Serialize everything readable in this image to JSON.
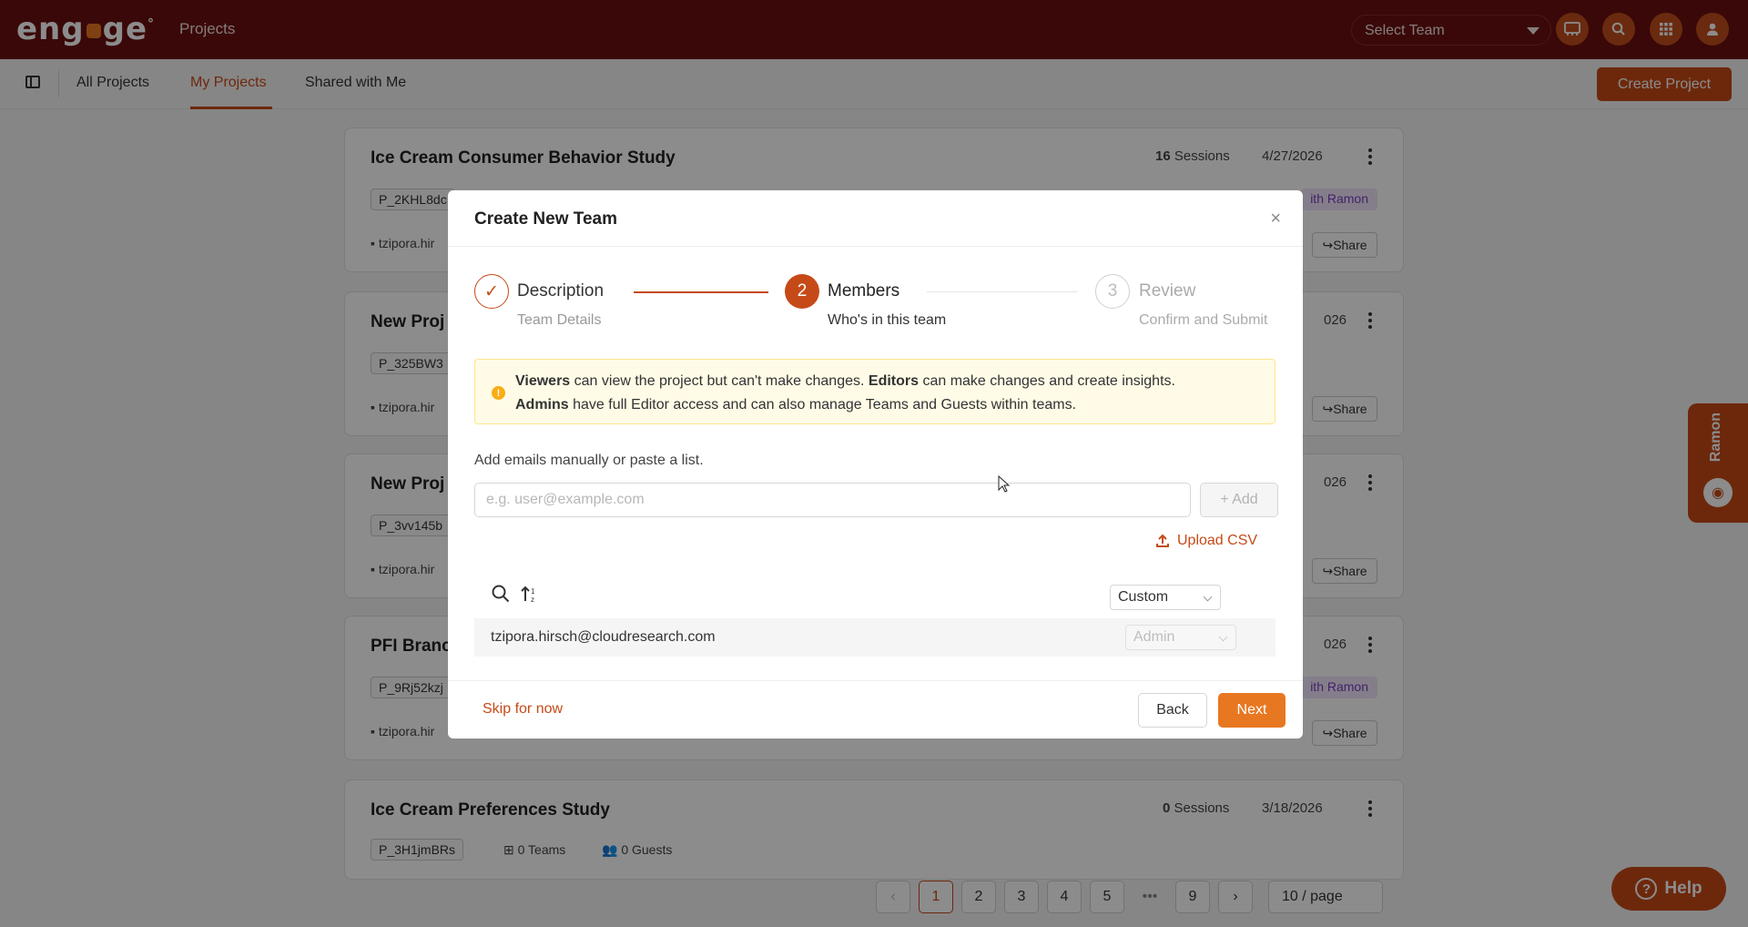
{
  "app": {
    "logo_left": "eng",
    "logo_right": "ge",
    "logo_tm": "°",
    "section_title": "Projects",
    "team_select_placeholder": "Select Team"
  },
  "icons": {
    "workspace": "workspace-icon",
    "search": "search-icon",
    "apps": "grid-icon",
    "user": "user-icon"
  },
  "subnav": {
    "tabs": [
      "All Projects",
      "My Projects",
      "Shared with Me"
    ],
    "active_tab": "My Projects",
    "create_button": "Create Project"
  },
  "cards": [
    {
      "title": "Ice Cream Consumer Behavior Study",
      "id": "P_2KHL8dc",
      "owner": "tzipora.hir",
      "sessions_count": "16",
      "sessions_label": "Sessions",
      "date": "4/27/2026",
      "tag": "ith Ramon",
      "share": "Share"
    },
    {
      "title": "New Proj",
      "id": "P_325BW3",
      "owner": "tzipora.hir",
      "sessions_count": "",
      "sessions_label": "",
      "date": "026",
      "tag": "",
      "share": "Share"
    },
    {
      "title": "New Proj",
      "id": "P_3vv145b",
      "owner": "tzipora.hir",
      "sessions_count": "",
      "sessions_label": "",
      "date": "026",
      "tag": "",
      "share": "Share"
    },
    {
      "title": "PFI Branc",
      "id": "P_9Rj52kzj",
      "owner": "tzipora.hir",
      "sessions_count": "",
      "sessions_label": "",
      "date": "026",
      "tag": "ith Ramon",
      "share": "Share"
    },
    {
      "title": "Ice Cream Preferences Study",
      "id": "P_3H1jmBRs",
      "owner": "",
      "sessions_count": "0",
      "sessions_label": "Sessions",
      "date": "3/18/2026",
      "teams": "0 Teams",
      "guests": "0 Guests",
      "tag": "",
      "share": ""
    }
  ],
  "pagination": {
    "pages": [
      "1",
      "2",
      "3",
      "4",
      "5"
    ],
    "ellipsis": "•••",
    "last_page": "9",
    "current": "1",
    "prev": "‹",
    "next": "›",
    "per_page": "10 / page"
  },
  "side_tab": {
    "label": "Ramon"
  },
  "help": {
    "label": "Help"
  },
  "modal": {
    "title": "Create New Team",
    "close": "×",
    "steps": [
      {
        "number": "✓",
        "title": "Description",
        "subtitle": "Team Details",
        "state": "done"
      },
      {
        "number": "2",
        "title": "Members",
        "subtitle": "Who's in this team",
        "state": "active"
      },
      {
        "number": "3",
        "title": "Review",
        "subtitle": "Confirm and Submit",
        "state": "pending"
      }
    ],
    "info": {
      "viewers_bold": "Viewers",
      "viewers_text": " can view the project but can't make changes. ",
      "editors_bold": "Editors",
      "editors_text": " can make changes and create insights.",
      "admins_bold": "Admins",
      "admins_text": " have full Editor access and can also manage Teams and Guests within teams."
    },
    "add_label": "Add emails manually or paste a list.",
    "email_placeholder": "e.g. user@example.com",
    "email_value": "",
    "add_button": "+ Add",
    "upload_csv": "Upload CSV",
    "default_role": "Custom",
    "members": [
      {
        "email": "tzipora.hirsch@cloudresearch.com",
        "role": "Admin"
      }
    ],
    "skip": "Skip for now",
    "back": "Back",
    "next": "Next"
  },
  "colors": {
    "brand_dark": "#6b0f0f",
    "accent": "#c64a17",
    "accent_bright": "#e87722"
  }
}
